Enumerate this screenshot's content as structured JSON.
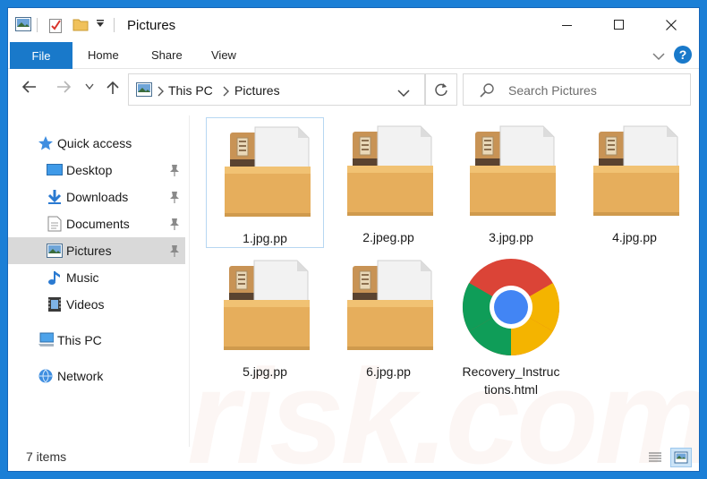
{
  "window": {
    "title": "Pictures"
  },
  "ribbon": {
    "tabs": [
      "File",
      "Home",
      "Share",
      "View"
    ],
    "help_label": "?"
  },
  "address": {
    "crumbs": [
      "This PC",
      "Pictures"
    ],
    "search_placeholder": "Search Pictures"
  },
  "navpane": {
    "items": [
      {
        "label": "Quick access",
        "icon": "star-icon",
        "pinned": false
      },
      {
        "label": "Desktop",
        "icon": "desktop-icon",
        "pinned": true
      },
      {
        "label": "Downloads",
        "icon": "download-icon",
        "pinned": true
      },
      {
        "label": "Documents",
        "icon": "documents-icon",
        "pinned": true
      },
      {
        "label": "Pictures",
        "icon": "pictures-icon",
        "pinned": true,
        "selected": true
      },
      {
        "label": "Music",
        "icon": "music-icon",
        "pinned": false
      },
      {
        "label": "Videos",
        "icon": "videos-icon",
        "pinned": false
      },
      {
        "label": "This PC",
        "icon": "computer-icon",
        "pinned": false
      },
      {
        "label": "Network",
        "icon": "network-icon",
        "pinned": false
      }
    ]
  },
  "files": [
    {
      "name": "1.jpg.pp",
      "icon": "archive-file-icon",
      "selected": true
    },
    {
      "name": "2.jpeg.pp",
      "icon": "archive-file-icon"
    },
    {
      "name": "3.jpg.pp",
      "icon": "archive-file-icon"
    },
    {
      "name": "4.jpg.pp",
      "icon": "archive-file-icon"
    },
    {
      "name": "5.jpg.pp",
      "icon": "archive-file-icon"
    },
    {
      "name": "6.jpg.pp",
      "icon": "archive-file-icon"
    },
    {
      "name": "Recovery_Instruc",
      "name2": "tions.html",
      "icon": "chrome-icon"
    }
  ],
  "status": {
    "count": "7 items"
  },
  "watermark": "risk.com",
  "colors": {
    "accent": "#1979ca",
    "selection": "#d9d9d9",
    "folder": "#e8b564"
  }
}
